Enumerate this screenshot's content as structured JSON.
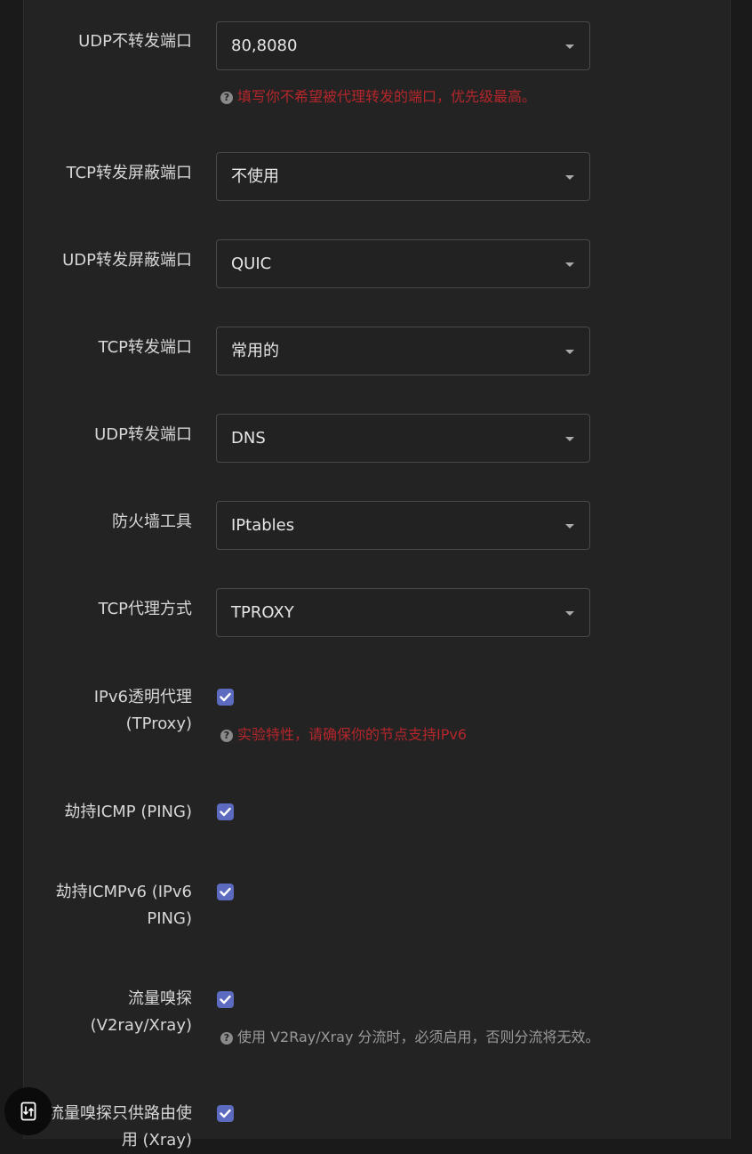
{
  "rows": {
    "udp_no_redir": {
      "label": "UDP不转发端口",
      "value": "80,8080",
      "hint": "填写你不希望被代理转发的端口，优先级最高。"
    },
    "tcp_block_ports": {
      "label": "TCP转发屏蔽端口",
      "value": "不使用"
    },
    "udp_block_ports": {
      "label": "UDP转发屏蔽端口",
      "value": "QUIC"
    },
    "tcp_redir_ports": {
      "label": "TCP转发端口",
      "value": "常用的"
    },
    "udp_redir_ports": {
      "label": "UDP转发端口",
      "value": "DNS"
    },
    "firewall_tool": {
      "label": "防火墙工具",
      "value": "IPtables"
    },
    "tcp_proxy_mode": {
      "label": "TCP代理方式",
      "value": "TPROXY"
    },
    "ipv6_tproxy": {
      "label_line1": "IPv6透明代理",
      "label_line2": "(TProxy)",
      "checked": true,
      "hint": "实验特性，请确保你的节点支持IPv6"
    },
    "hijack_icmp": {
      "label": "劫持ICMP (PING)",
      "checked": true
    },
    "hijack_icmpv6": {
      "label_line1": "劫持ICMPv6 (IPv6",
      "label_line2": "PING)",
      "checked": true
    },
    "sniffing": {
      "label_line1": "流量嗅探",
      "label_line2": "(V2ray/Xray)",
      "checked": true,
      "hint": "使用 V2Ray/Xray 分流时，必须启用，否则分流将无效。"
    },
    "route_only": {
      "label_line1": "流量嗅探只供路由使",
      "label_line2": "用 (Xray)",
      "checked": true
    }
  },
  "colors": {
    "accent": "#5c6bc0",
    "hint_red": "#b3262b",
    "hint_gray": "#9a9a9a",
    "background": "#232323"
  },
  "icons": {
    "help": "question-circle-icon",
    "fab": "swap-icon"
  }
}
